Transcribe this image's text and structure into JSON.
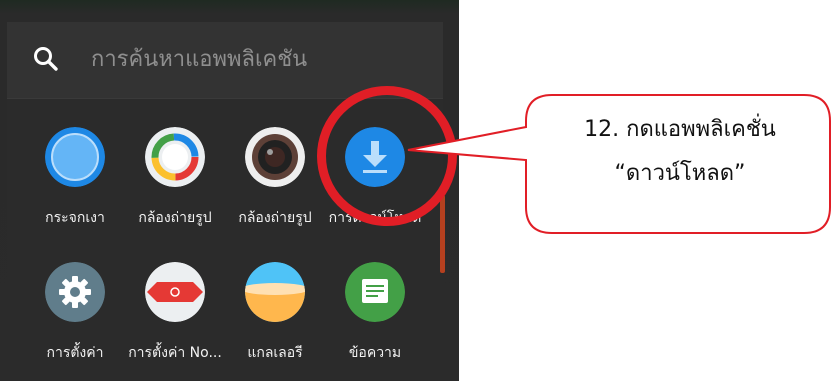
{
  "search": {
    "placeholder": "การค้นหาแอพพลิเคชัน"
  },
  "apps": [
    {
      "label": "กระจกเงา",
      "icon": "mirror-icon"
    },
    {
      "label": "กล้องถ่ายรูป",
      "icon": "camera-color-icon"
    },
    {
      "label": "กล้องถ่ายรูป",
      "icon": "camera-lens-icon"
    },
    {
      "label": "การดาวน์โหลด",
      "icon": "download-icon"
    },
    {
      "label": "การตั้งค่า",
      "icon": "settings-gear-icon"
    },
    {
      "label": "การตั้งค่า No...",
      "icon": "settings-nova-icon"
    },
    {
      "label": "แกลเลอรี",
      "icon": "gallery-icon"
    },
    {
      "label": "ข้อความ",
      "icon": "messages-icon"
    }
  ],
  "callout": {
    "line1": "12. กดแอพพลิเคชั่น",
    "line2": "“ดาวน์โหลด”"
  },
  "colors": {
    "highlight": "#e11e26",
    "drawer_bg": "#2b2b2b",
    "search_bg": "#333333"
  }
}
